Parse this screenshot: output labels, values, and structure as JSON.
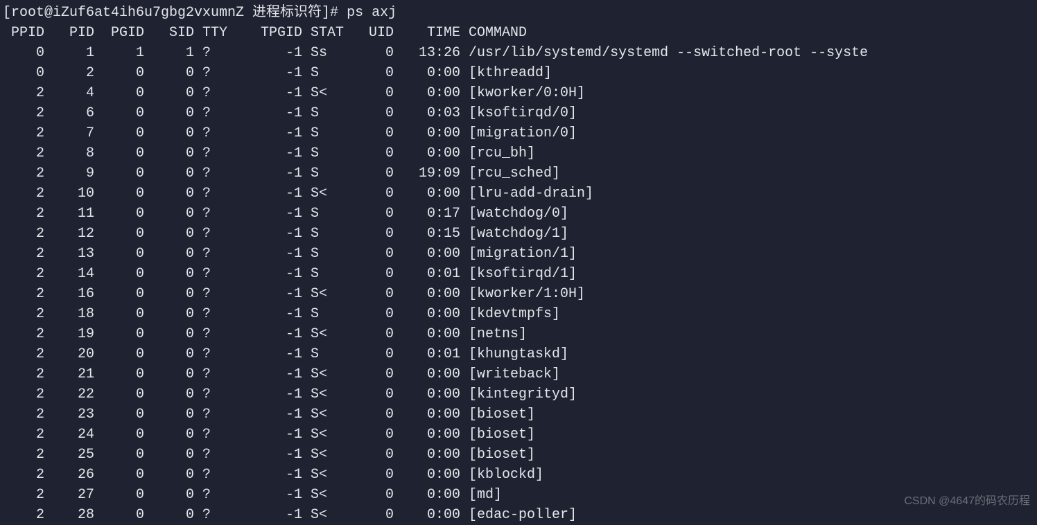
{
  "prompt": {
    "left": "[root@iZuf6at4ih6u7gbg2vxumnZ 进程标识符]#",
    "command": "ps axj"
  },
  "headers": {
    "ppid": "PPID",
    "pid": "PID",
    "pgid": "PGID",
    "sid": "SID",
    "tty": "TTY",
    "tpgid": "TPGID",
    "stat": "STAT",
    "uid": "UID",
    "time": "TIME",
    "command": "COMMAND"
  },
  "rows": [
    {
      "ppid": "0",
      "pid": "1",
      "pgid": "1",
      "sid": "1",
      "tty": "?",
      "tpgid": "-1",
      "stat": "Ss",
      "uid": "0",
      "time": "13:26",
      "command": "/usr/lib/systemd/systemd --switched-root --syste"
    },
    {
      "ppid": "0",
      "pid": "2",
      "pgid": "0",
      "sid": "0",
      "tty": "?",
      "tpgid": "-1",
      "stat": "S",
      "uid": "0",
      "time": "0:00",
      "command": "[kthreadd]"
    },
    {
      "ppid": "2",
      "pid": "4",
      "pgid": "0",
      "sid": "0",
      "tty": "?",
      "tpgid": "-1",
      "stat": "S<",
      "uid": "0",
      "time": "0:00",
      "command": "[kworker/0:0H]"
    },
    {
      "ppid": "2",
      "pid": "6",
      "pgid": "0",
      "sid": "0",
      "tty": "?",
      "tpgid": "-1",
      "stat": "S",
      "uid": "0",
      "time": "0:03",
      "command": "[ksoftirqd/0]"
    },
    {
      "ppid": "2",
      "pid": "7",
      "pgid": "0",
      "sid": "0",
      "tty": "?",
      "tpgid": "-1",
      "stat": "S",
      "uid": "0",
      "time": "0:00",
      "command": "[migration/0]"
    },
    {
      "ppid": "2",
      "pid": "8",
      "pgid": "0",
      "sid": "0",
      "tty": "?",
      "tpgid": "-1",
      "stat": "S",
      "uid": "0",
      "time": "0:00",
      "command": "[rcu_bh]"
    },
    {
      "ppid": "2",
      "pid": "9",
      "pgid": "0",
      "sid": "0",
      "tty": "?",
      "tpgid": "-1",
      "stat": "S",
      "uid": "0",
      "time": "19:09",
      "command": "[rcu_sched]"
    },
    {
      "ppid": "2",
      "pid": "10",
      "pgid": "0",
      "sid": "0",
      "tty": "?",
      "tpgid": "-1",
      "stat": "S<",
      "uid": "0",
      "time": "0:00",
      "command": "[lru-add-drain]"
    },
    {
      "ppid": "2",
      "pid": "11",
      "pgid": "0",
      "sid": "0",
      "tty": "?",
      "tpgid": "-1",
      "stat": "S",
      "uid": "0",
      "time": "0:17",
      "command": "[watchdog/0]"
    },
    {
      "ppid": "2",
      "pid": "12",
      "pgid": "0",
      "sid": "0",
      "tty": "?",
      "tpgid": "-1",
      "stat": "S",
      "uid": "0",
      "time": "0:15",
      "command": "[watchdog/1]"
    },
    {
      "ppid": "2",
      "pid": "13",
      "pgid": "0",
      "sid": "0",
      "tty": "?",
      "tpgid": "-1",
      "stat": "S",
      "uid": "0",
      "time": "0:00",
      "command": "[migration/1]"
    },
    {
      "ppid": "2",
      "pid": "14",
      "pgid": "0",
      "sid": "0",
      "tty": "?",
      "tpgid": "-1",
      "stat": "S",
      "uid": "0",
      "time": "0:01",
      "command": "[ksoftirqd/1]"
    },
    {
      "ppid": "2",
      "pid": "16",
      "pgid": "0",
      "sid": "0",
      "tty": "?",
      "tpgid": "-1",
      "stat": "S<",
      "uid": "0",
      "time": "0:00",
      "command": "[kworker/1:0H]"
    },
    {
      "ppid": "2",
      "pid": "18",
      "pgid": "0",
      "sid": "0",
      "tty": "?",
      "tpgid": "-1",
      "stat": "S",
      "uid": "0",
      "time": "0:00",
      "command": "[kdevtmpfs]"
    },
    {
      "ppid": "2",
      "pid": "19",
      "pgid": "0",
      "sid": "0",
      "tty": "?",
      "tpgid": "-1",
      "stat": "S<",
      "uid": "0",
      "time": "0:00",
      "command": "[netns]"
    },
    {
      "ppid": "2",
      "pid": "20",
      "pgid": "0",
      "sid": "0",
      "tty": "?",
      "tpgid": "-1",
      "stat": "S",
      "uid": "0",
      "time": "0:01",
      "command": "[khungtaskd]"
    },
    {
      "ppid": "2",
      "pid": "21",
      "pgid": "0",
      "sid": "0",
      "tty": "?",
      "tpgid": "-1",
      "stat": "S<",
      "uid": "0",
      "time": "0:00",
      "command": "[writeback]"
    },
    {
      "ppid": "2",
      "pid": "22",
      "pgid": "0",
      "sid": "0",
      "tty": "?",
      "tpgid": "-1",
      "stat": "S<",
      "uid": "0",
      "time": "0:00",
      "command": "[kintegrityd]"
    },
    {
      "ppid": "2",
      "pid": "23",
      "pgid": "0",
      "sid": "0",
      "tty": "?",
      "tpgid": "-1",
      "stat": "S<",
      "uid": "0",
      "time": "0:00",
      "command": "[bioset]"
    },
    {
      "ppid": "2",
      "pid": "24",
      "pgid": "0",
      "sid": "0",
      "tty": "?",
      "tpgid": "-1",
      "stat": "S<",
      "uid": "0",
      "time": "0:00",
      "command": "[bioset]"
    },
    {
      "ppid": "2",
      "pid": "25",
      "pgid": "0",
      "sid": "0",
      "tty": "?",
      "tpgid": "-1",
      "stat": "S<",
      "uid": "0",
      "time": "0:00",
      "command": "[bioset]"
    },
    {
      "ppid": "2",
      "pid": "26",
      "pgid": "0",
      "sid": "0",
      "tty": "?",
      "tpgid": "-1",
      "stat": "S<",
      "uid": "0",
      "time": "0:00",
      "command": "[kblockd]"
    },
    {
      "ppid": "2",
      "pid": "27",
      "pgid": "0",
      "sid": "0",
      "tty": "?",
      "tpgid": "-1",
      "stat": "S<",
      "uid": "0",
      "time": "0:00",
      "command": "[md]"
    },
    {
      "ppid": "2",
      "pid": "28",
      "pgid": "0",
      "sid": "0",
      "tty": "?",
      "tpgid": "-1",
      "stat": "S<",
      "uid": "0",
      "time": "0:00",
      "command": "[edac-poller]"
    }
  ],
  "watermark": "CSDN @4647的码农历程"
}
